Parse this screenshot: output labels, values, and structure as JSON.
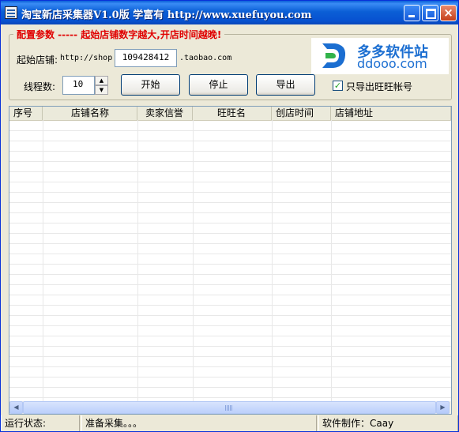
{
  "window": {
    "title": "淘宝新店采集器V1.0版  学富有 http://www.xuefuyou.com",
    "close_glyph": "×"
  },
  "config": {
    "group_title": "配置参数 ----- 起始店铺数字越大,开店时间越晚!",
    "start_shop_label": "起始店铺:",
    "url_prefix": "http://shop",
    "start_shop_value": "109428412",
    "url_suffix": ".taobao.com",
    "threads_label": "线程数:",
    "threads_value": "10",
    "start_button": "开始",
    "stop_button": "停止",
    "export_button": "导出",
    "export_only_ww_label": "只导出旺旺帐号",
    "export_only_ww_checked": true
  },
  "logo": {
    "top": "多多软件站",
    "bottom": "ddooo.com",
    "color": "#1b6ed1"
  },
  "table": {
    "columns": [
      "序号",
      "店铺名称",
      "卖家信誉",
      "旺旺名",
      "创店时间",
      "店铺地址"
    ],
    "rows": []
  },
  "status": {
    "label": "运行状态:",
    "message": "准备采集。。。",
    "author": "软件制作：Caay"
  }
}
